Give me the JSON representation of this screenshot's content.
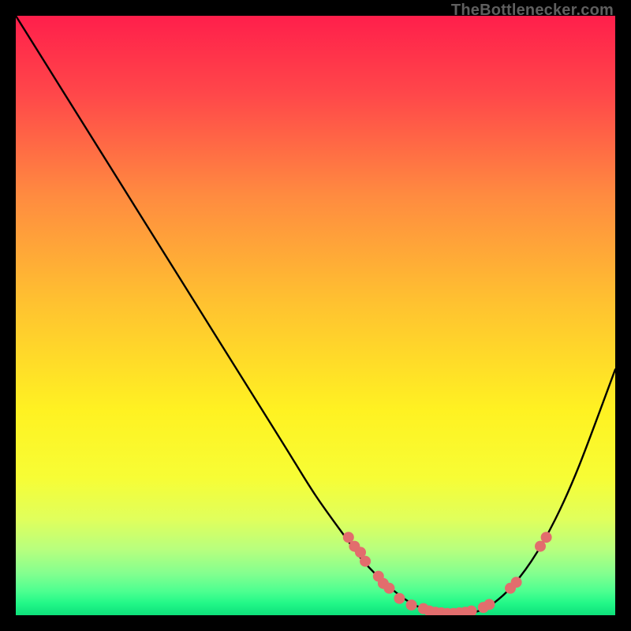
{
  "watermark": "TheBottlenecker.com",
  "chart_data": {
    "type": "line",
    "title": "",
    "xlabel": "",
    "ylabel": "",
    "xlim": [
      0,
      100
    ],
    "ylim": [
      0,
      100
    ],
    "grid": false,
    "legend": false,
    "background_gradient": [
      {
        "offset": 0.0,
        "color": "#ff1f4b"
      },
      {
        "offset": 0.13,
        "color": "#ff474a"
      },
      {
        "offset": 0.3,
        "color": "#ff8b40"
      },
      {
        "offset": 0.48,
        "color": "#ffc230"
      },
      {
        "offset": 0.66,
        "color": "#fff222"
      },
      {
        "offset": 0.77,
        "color": "#f7fd35"
      },
      {
        "offset": 0.84,
        "color": "#e0ff5c"
      },
      {
        "offset": 0.89,
        "color": "#b8ff7e"
      },
      {
        "offset": 0.93,
        "color": "#84ff8f"
      },
      {
        "offset": 0.96,
        "color": "#4dff90"
      },
      {
        "offset": 0.98,
        "color": "#22f888"
      },
      {
        "offset": 1.0,
        "color": "#0ee07a"
      }
    ],
    "curve": {
      "description": "smooth bottleneck curve descending from top-left to a flat basin around x≈66–78 near y≈0, then rising toward the right edge",
      "x": [
        0,
        5,
        10,
        15,
        20,
        25,
        30,
        35,
        40,
        45,
        50,
        55,
        58,
        62,
        66,
        70,
        74,
        78,
        82,
        86,
        90,
        94,
        100
      ],
      "y": [
        100,
        92,
        84,
        76,
        68,
        60,
        52,
        44,
        36,
        28,
        20,
        13,
        9,
        5,
        2,
        0.5,
        0.3,
        1,
        4,
        9,
        16,
        25,
        41
      ]
    },
    "markers": {
      "color": "#e26d6d",
      "radius_px": 7,
      "points": [
        {
          "x": 55.5,
          "y": 13.0
        },
        {
          "x": 56.5,
          "y": 11.5
        },
        {
          "x": 57.5,
          "y": 10.5
        },
        {
          "x": 58.3,
          "y": 9.0
        },
        {
          "x": 60.5,
          "y": 6.5
        },
        {
          "x": 61.3,
          "y": 5.3
        },
        {
          "x": 62.3,
          "y": 4.5
        },
        {
          "x": 64.0,
          "y": 2.8
        },
        {
          "x": 66.0,
          "y": 1.7
        },
        {
          "x": 68.0,
          "y": 1.1
        },
        {
          "x": 69.0,
          "y": 0.7
        },
        {
          "x": 70.0,
          "y": 0.5
        },
        {
          "x": 71.0,
          "y": 0.4
        },
        {
          "x": 72.0,
          "y": 0.3
        },
        {
          "x": 73.0,
          "y": 0.3
        },
        {
          "x": 74.0,
          "y": 0.4
        },
        {
          "x": 75.0,
          "y": 0.5
        },
        {
          "x": 76.0,
          "y": 0.7
        },
        {
          "x": 78.0,
          "y": 1.3
        },
        {
          "x": 79.0,
          "y": 1.8
        },
        {
          "x": 82.5,
          "y": 4.5
        },
        {
          "x": 83.5,
          "y": 5.5
        },
        {
          "x": 87.5,
          "y": 11.5
        },
        {
          "x": 88.5,
          "y": 13.0
        }
      ]
    }
  }
}
